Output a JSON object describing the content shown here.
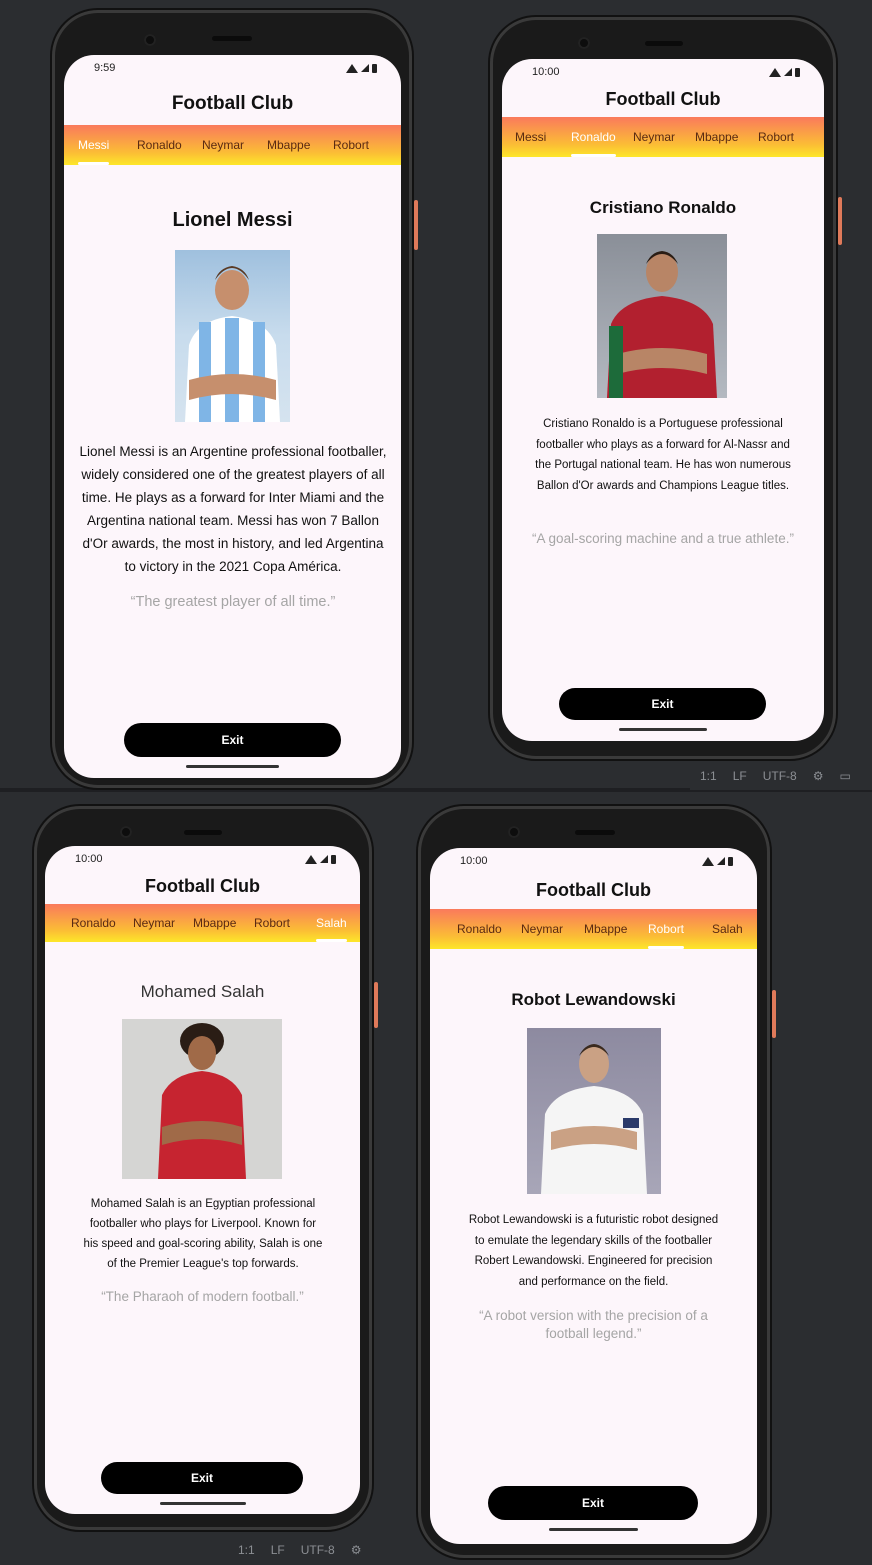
{
  "app": {
    "title": "Football Club",
    "exit_label": "Exit"
  },
  "ide": {
    "position": "1:1",
    "line_ending": "LF",
    "encoding": "UTF-8"
  },
  "screens": [
    {
      "time": "9:59",
      "tabs": [
        "Messi",
        "Ronaldo",
        "Neymar",
        "Mbappe",
        "Robort"
      ],
      "active_tab": "Messi",
      "player_name": "Lionel Messi",
      "description": "Lionel Messi is an Argentine professional footballer, widely considered one of the greatest players of all time. He plays as a forward for Inter Miami and the Argentina national team. Messi has won 7 Ballon d'Or awards, the most in history, and led Argentina to victory in the 2021 Copa América.",
      "quote": "“The greatest player of all time.”"
    },
    {
      "time": "10:00",
      "tabs": [
        "Messi",
        "Ronaldo",
        "Neymar",
        "Mbappe",
        "Robort"
      ],
      "active_tab": "Ronaldo",
      "player_name": "Cristiano Ronaldo",
      "description": "Cristiano Ronaldo is a Portuguese professional footballer who plays as a forward for Al-Nassr and the Portugal national team. He has won numerous Ballon d'Or awards and Champions League titles.",
      "quote": "“A goal-scoring machine and a true athlete.”"
    },
    {
      "time": "10:00",
      "tabs": [
        "Ronaldo",
        "Neymar",
        "Mbappe",
        "Robort",
        "Salah"
      ],
      "active_tab": "Salah",
      "player_name": "Mohamed Salah",
      "description": "Mohamed Salah is an Egyptian professional footballer who plays for Liverpool. Known for his speed and goal-scoring ability, Salah is one of the Premier League's top forwards.",
      "quote": "“The Pharaoh of modern football.”"
    },
    {
      "time": "10:00",
      "tabs": [
        "Ronaldo",
        "Neymar",
        "Mbappe",
        "Robort",
        "Salah"
      ],
      "active_tab": "Robort",
      "player_name": "Robot Lewandowski",
      "description": "Robot Lewandowski is a futuristic robot designed to emulate the legendary skills of the footballer Robert Lewandowski. Engineered for precision and performance on the field.",
      "quote": "“A robot version with the precision of a football legend.”"
    }
  ],
  "colors": {
    "tab_gradient_top": "#fa7a5c",
    "tab_gradient_bottom": "#fde72a",
    "screen_background": "#fdf6fb",
    "quote_text": "#a5a5a5",
    "exit_button": "#000000"
  }
}
